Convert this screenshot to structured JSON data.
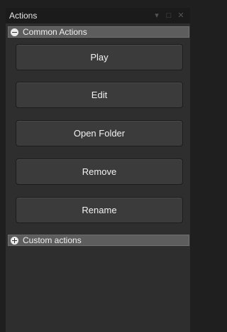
{
  "window": {
    "title": "Actions",
    "controls": [
      {
        "name": "dropdown-icon",
        "glyph": "▾"
      },
      {
        "name": "maximize-icon",
        "glyph": "□"
      },
      {
        "name": "close-icon",
        "glyph": "✕"
      }
    ]
  },
  "common_actions": {
    "label": "Common Actions",
    "expanded": true,
    "buttons": [
      {
        "label": "Play"
      },
      {
        "label": "Edit"
      },
      {
        "label": "Open Folder"
      },
      {
        "label": "Remove"
      },
      {
        "label": "Rename"
      }
    ]
  },
  "custom_actions": {
    "label": "Custom actions",
    "expanded": false
  },
  "colors": {
    "panel_bg": "#2e2e2e",
    "titlebar_bg": "#1b1b1b",
    "section_header_bg": "#5d5d5d",
    "button_bg": "#3b3b3b",
    "text": "#f2f2f2"
  }
}
